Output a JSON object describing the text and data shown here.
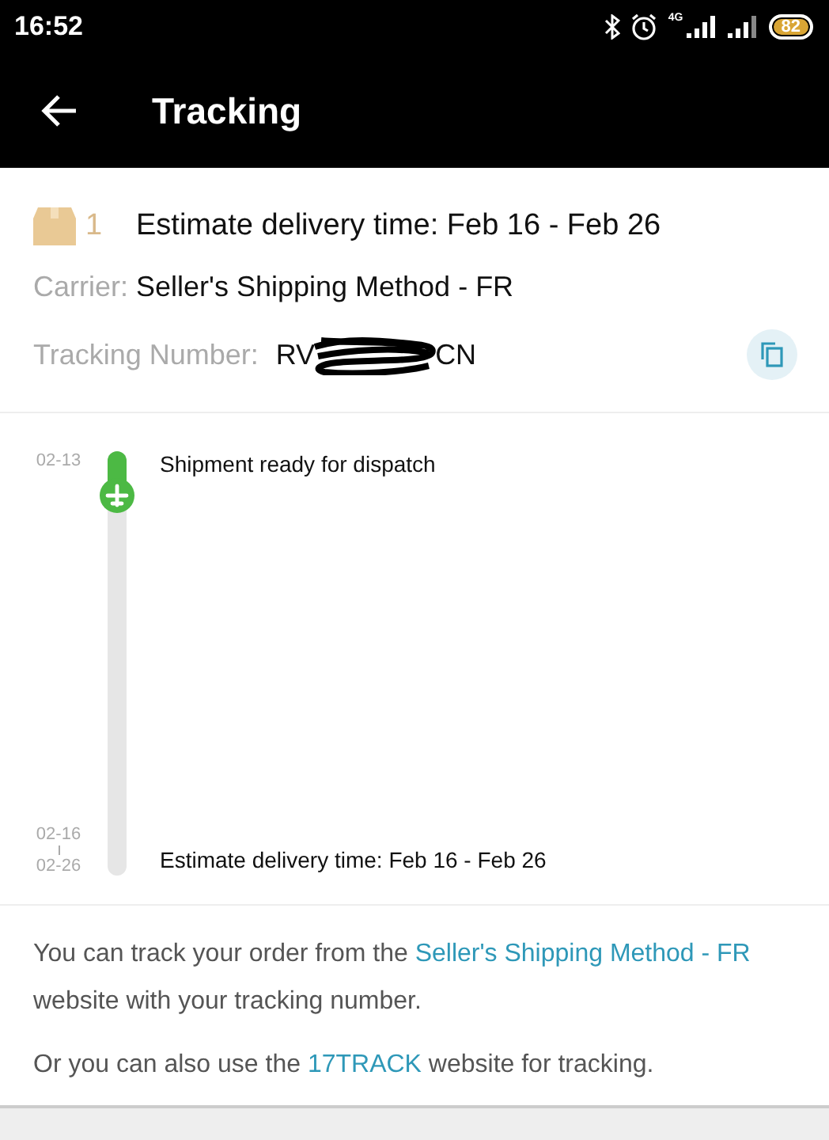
{
  "status_bar": {
    "time": "16:52",
    "network": "4G",
    "battery": "82"
  },
  "app_bar": {
    "title": "Tracking"
  },
  "package": {
    "count": "1",
    "estimate": "Estimate delivery time: Feb 16 - Feb 26",
    "carrier_label": "Carrier:",
    "carrier": "Seller's Shipping Method - FR",
    "tracking_label": "Tracking Number:",
    "tracking_start": "RV",
    "tracking_end": "CN"
  },
  "events": [
    {
      "dates": [
        "02-13"
      ],
      "text": "Shipment ready for dispatch",
      "reached": true
    },
    {
      "dates": [
        "02-16",
        "02-26"
      ],
      "text": "Estimate delivery time: Feb 16 - Feb 26",
      "reached": false
    }
  ],
  "footer": [
    {
      "before": "You can track your order from the ",
      "link": "Seller's Shipping Method - FR",
      "after": " website with your tracking number."
    },
    {
      "before": "Or you can also use the ",
      "link": "17TRACK",
      "after": " website for tracking."
    }
  ]
}
